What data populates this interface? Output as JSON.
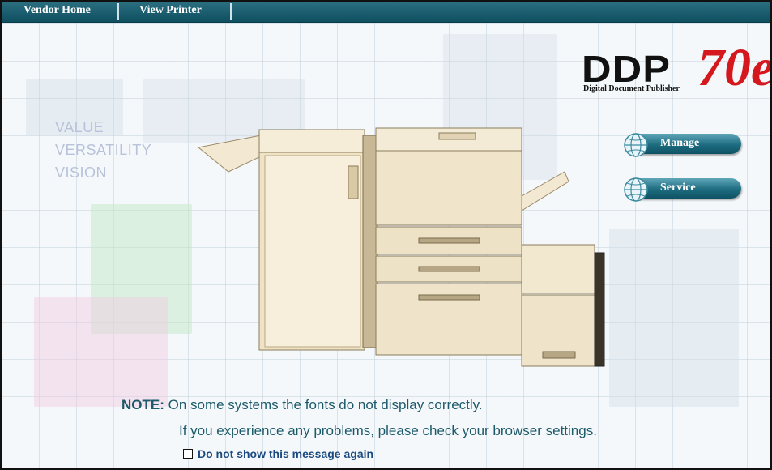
{
  "nav": {
    "vendor_home": "Vendor Home",
    "view_printer": "View Printer"
  },
  "tagline": {
    "line1": "VALUE",
    "line2": "VERSATILITY",
    "line3": "VISION"
  },
  "logo": {
    "brand": "DDP",
    "model": "70e",
    "subtitle": "Digital Document Publisher"
  },
  "actions": {
    "manage_label": "Manage",
    "service_label": "Service",
    "icon": "globe-icon"
  },
  "note": {
    "prefix": "NOTE:",
    "line1": " On some systems the fonts do not display correctly.",
    "line2": "If you experience any problems, please check your browser settings.",
    "checkbox_label": "Do not show this message again",
    "checkbox_checked": false
  },
  "colors": {
    "nav_bar": "#1b5f70",
    "button_teal": "#1e6c80",
    "logo_red": "#d4181e",
    "note_text": "#1c5a6a"
  }
}
